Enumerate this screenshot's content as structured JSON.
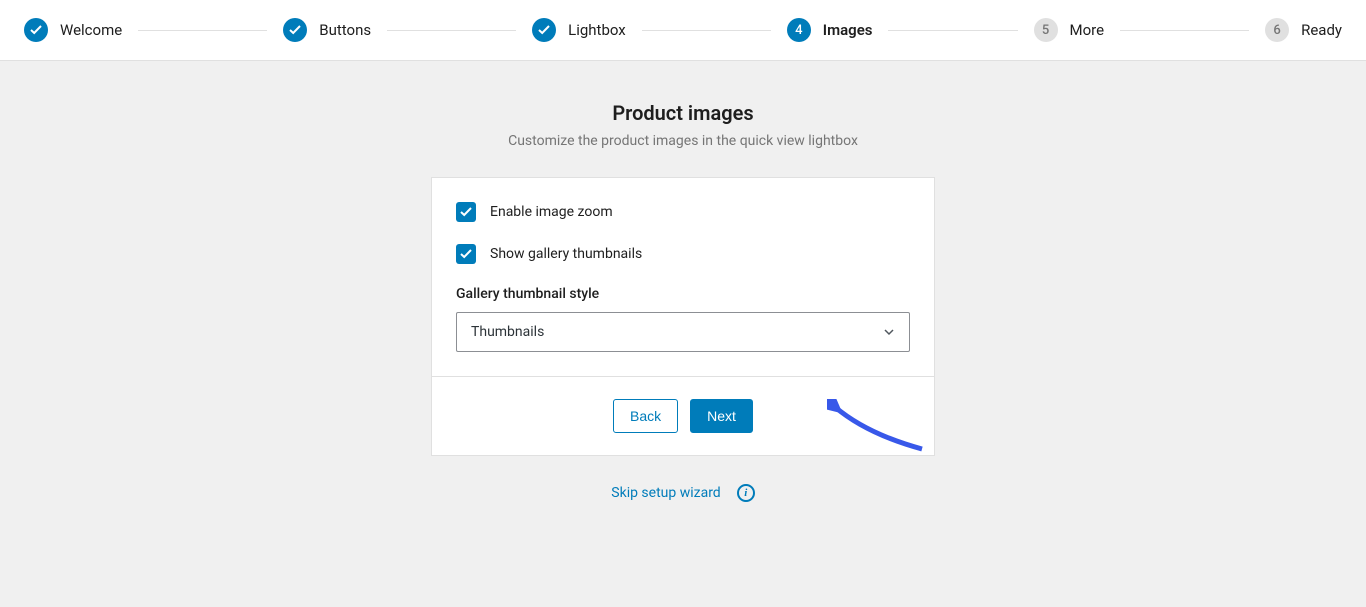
{
  "stepper": {
    "steps": [
      {
        "label": "Welcome",
        "status": "done"
      },
      {
        "label": "Buttons",
        "status": "done"
      },
      {
        "label": "Lightbox",
        "status": "done"
      },
      {
        "label": "Images",
        "status": "current",
        "num": "4"
      },
      {
        "label": "More",
        "status": "pending",
        "num": "5"
      },
      {
        "label": "Ready",
        "status": "pending",
        "num": "6"
      }
    ]
  },
  "header": {
    "title": "Product images",
    "subtitle": "Customize the product images in the quick view lightbox"
  },
  "form": {
    "enable_zoom_label": "Enable image zoom",
    "enable_zoom_checked": true,
    "show_thumbnails_label": "Show gallery thumbnails",
    "show_thumbnails_checked": true,
    "gallery_style_label": "Gallery thumbnail style",
    "gallery_style_value": "Thumbnails"
  },
  "buttons": {
    "back": "Back",
    "next": "Next"
  },
  "footer": {
    "skip": "Skip setup wizard"
  }
}
